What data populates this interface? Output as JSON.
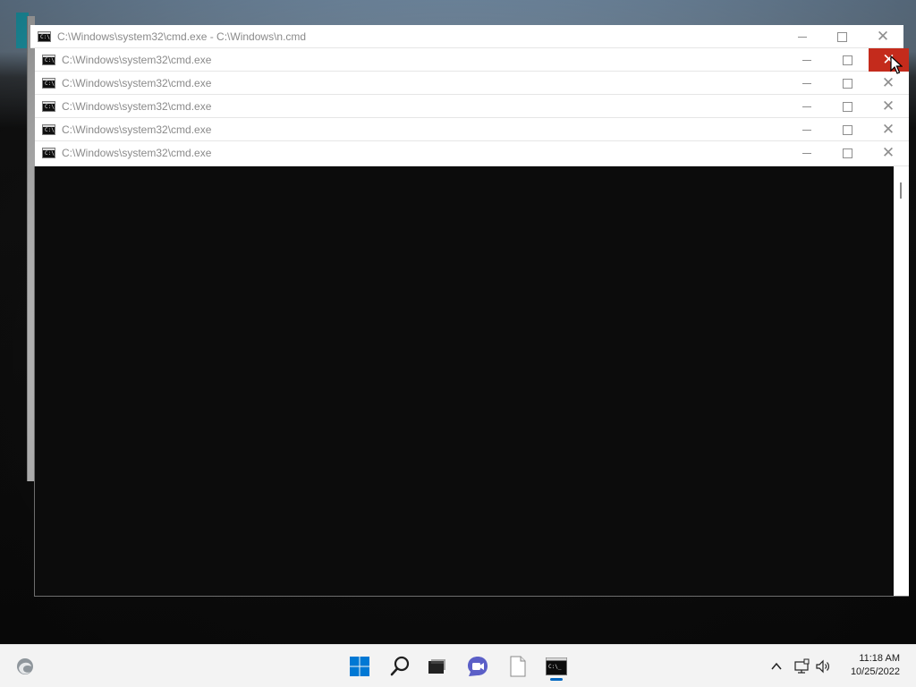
{
  "windows": [
    {
      "title": "C:\\Windows\\system32\\cmd.exe - C:\\Windows\\n.cmd"
    },
    {
      "title": "C:\\Windows\\system32\\cmd.exe"
    },
    {
      "title": "C:\\Windows\\system32\\cmd.exe"
    },
    {
      "title": "C:\\Windows\\system32\\cmd.exe"
    },
    {
      "title": "C:\\Windows\\system32\\cmd.exe"
    },
    {
      "title": "C:\\Windows\\system32\\cmd.exe"
    }
  ],
  "icons": {
    "app": "command-prompt-icon",
    "minimize": "minimize-icon",
    "maximize": "maximize-icon",
    "close": "close-icon"
  },
  "colors": {
    "close_hover": "#c42b1c",
    "console_bg": "#0c0c0c",
    "taskbar_bg": "#f3f3f3",
    "start_blue": "#0078d4",
    "active_indicator": "#0067c0"
  },
  "taskbar": {
    "items": [
      "edge-icon",
      "start-icon",
      "search-icon",
      "task-view-icon",
      "chat-icon",
      "file-icon",
      "command-prompt-icon"
    ],
    "tray": [
      "chevron-up-icon",
      "network-icon",
      "volume-icon"
    ],
    "clock": {
      "time": "11:18 AM",
      "date": "10/25/2022"
    }
  }
}
